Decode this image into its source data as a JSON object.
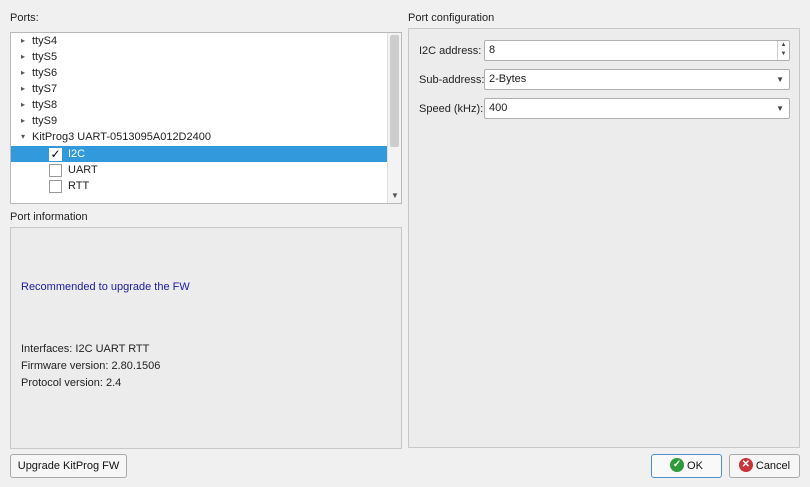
{
  "ports": {
    "label": "Ports:",
    "items": [
      {
        "label": "ttyS4",
        "expanded": false
      },
      {
        "label": "ttyS5",
        "expanded": false
      },
      {
        "label": "ttyS6",
        "expanded": false
      },
      {
        "label": "ttyS7",
        "expanded": false
      },
      {
        "label": "ttyS8",
        "expanded": false
      },
      {
        "label": "ttyS9",
        "expanded": false
      },
      {
        "label": "KitProg3 UART-0513095A012D2400",
        "expanded": true
      }
    ],
    "children": [
      {
        "label": "I2C",
        "checked": true,
        "selected": true
      },
      {
        "label": "UART",
        "checked": false,
        "selected": false
      },
      {
        "label": "RTT",
        "checked": false,
        "selected": false
      }
    ],
    "check_mark": "✓"
  },
  "port_info": {
    "label": "Port information",
    "warning": "Recommended to upgrade the FW",
    "interfaces": "Interfaces: I2C UART RTT",
    "firmware": "Firmware version: 2.80.1506",
    "protocol": "Protocol version: 2.4"
  },
  "port_config": {
    "label": "Port configuration",
    "i2c_address_label": "I2C address:",
    "i2c_address_value": "8",
    "sub_address_label": "Sub-address:",
    "sub_address_value": "2-Bytes",
    "speed_label": "Speed (kHz):",
    "speed_value": "400"
  },
  "buttons": {
    "upgrade": "Upgrade KitProg FW",
    "ok": "OK",
    "cancel": "Cancel"
  },
  "icons": {
    "collapsed_arrow": "▸",
    "expanded_arrow": "▾",
    "spin_up": "▲",
    "spin_down": "▼",
    "dropdown": "▼",
    "ok": "✓",
    "cancel": "✕"
  },
  "colors": {
    "selection": "#3399dd",
    "warning_text": "#1a1aa6",
    "ok_icon": "#2e9b3a",
    "cancel_icon": "#c8343a"
  }
}
